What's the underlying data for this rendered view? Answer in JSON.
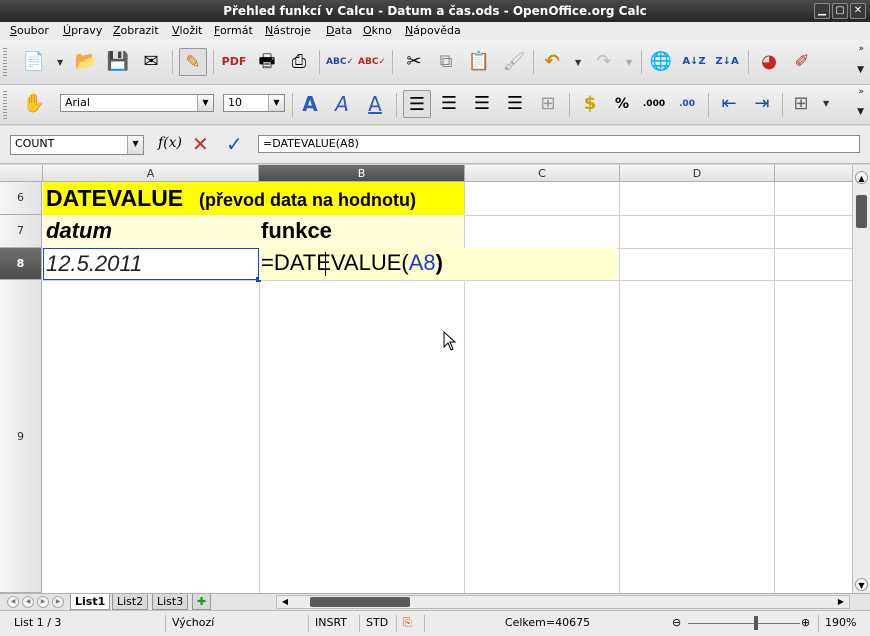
{
  "window": {
    "title": "Přehled funkcí v Calcu - Datum a čas.ods - OpenOffice.org Calc"
  },
  "menu": [
    "Soubor",
    "Úpravy",
    "Zobrazit",
    "Vložit",
    "Formát",
    "Nástroje",
    "Data",
    "Okno",
    "Nápověda"
  ],
  "formatting": {
    "font_name": "Arial",
    "font_size": "10"
  },
  "formula_bar": {
    "name_box": "COUNT",
    "formula": "=DATEVALUE(A8)"
  },
  "columns": [
    "A",
    "B",
    "C",
    "D"
  ],
  "rows": [
    "6",
    "7",
    "8",
    "9"
  ],
  "cells": {
    "a6_main": "DATEVALUE",
    "a6_sub": "(převod data na hodnotu)",
    "a7": "datum",
    "b7": "funkce",
    "a8": "12.5.2011",
    "b8_prefix": "=DATEVALUE(",
    "b8_ref": "A8",
    "b8_suffix": ")"
  },
  "colors": {
    "title_highlight": "#ffff00",
    "formula_edit_bg": "#ffffcc",
    "ref_blue": "#1c3cc8"
  },
  "sheets": [
    "List1",
    "List2",
    "List3"
  ],
  "status": {
    "sheet": "List 1 / 3",
    "style": "Výchozí",
    "mode": "INSRT",
    "selection": "STD",
    "sum": "Celkem=40675",
    "zoom": "190%"
  },
  "icons": [
    "new-icon",
    "open-icon",
    "save-icon",
    "email-icon",
    "edit-file-icon",
    "pdf-icon",
    "print-icon",
    "print-preview-icon",
    "spellcheck-icon",
    "autospell-icon",
    "cut-icon",
    "copy-icon",
    "paste-icon",
    "format-paintbrush-icon",
    "undo-icon",
    "redo-icon",
    "hyperlink-icon",
    "sort-ascending-icon",
    "sort-descending-icon",
    "chart-icon",
    "draw-icon"
  ]
}
